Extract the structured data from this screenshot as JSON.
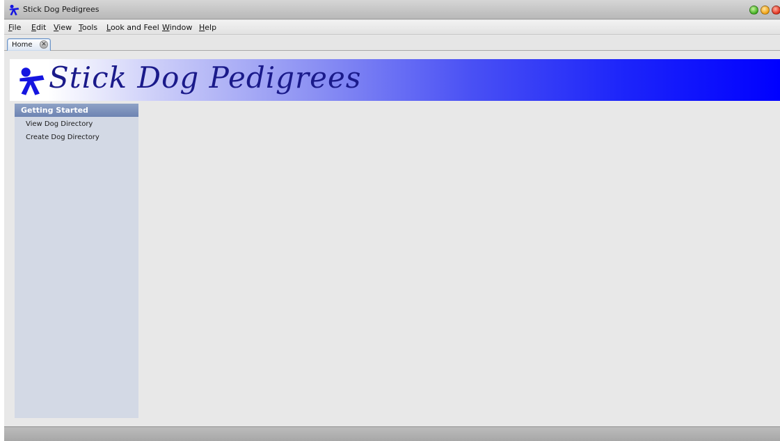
{
  "window": {
    "title": "Stick Dog Pedigrees",
    "icon": "stick-dog-icon"
  },
  "menubar": {
    "items": [
      {
        "mnemonic": "F",
        "rest": "ile"
      },
      {
        "mnemonic": "E",
        "rest": "dit"
      },
      {
        "mnemonic": "V",
        "rest": "iew"
      },
      {
        "mnemonic": "T",
        "rest": "ools"
      },
      {
        "mnemonic": "L",
        "rest": "ook and Feel"
      },
      {
        "mnemonic": "W",
        "rest": "indow"
      },
      {
        "mnemonic": "H",
        "rest": "elp"
      }
    ]
  },
  "tabs": [
    {
      "label": "Home",
      "close_glyph": "✕"
    }
  ],
  "banner": {
    "brand": "Stick Dog Pedigrees",
    "gradient_end_color": "#0000ff",
    "brand_color": "#1a1a8a"
  },
  "nav": {
    "header": "Getting Started",
    "links": [
      {
        "label": "View Dog Directory"
      },
      {
        "label": "Create Dog Directory"
      }
    ]
  },
  "colors": {
    "nav_header": "#7a8fbc",
    "nav_background": "#d3d9e5",
    "logo_blue": "#1515e0"
  }
}
